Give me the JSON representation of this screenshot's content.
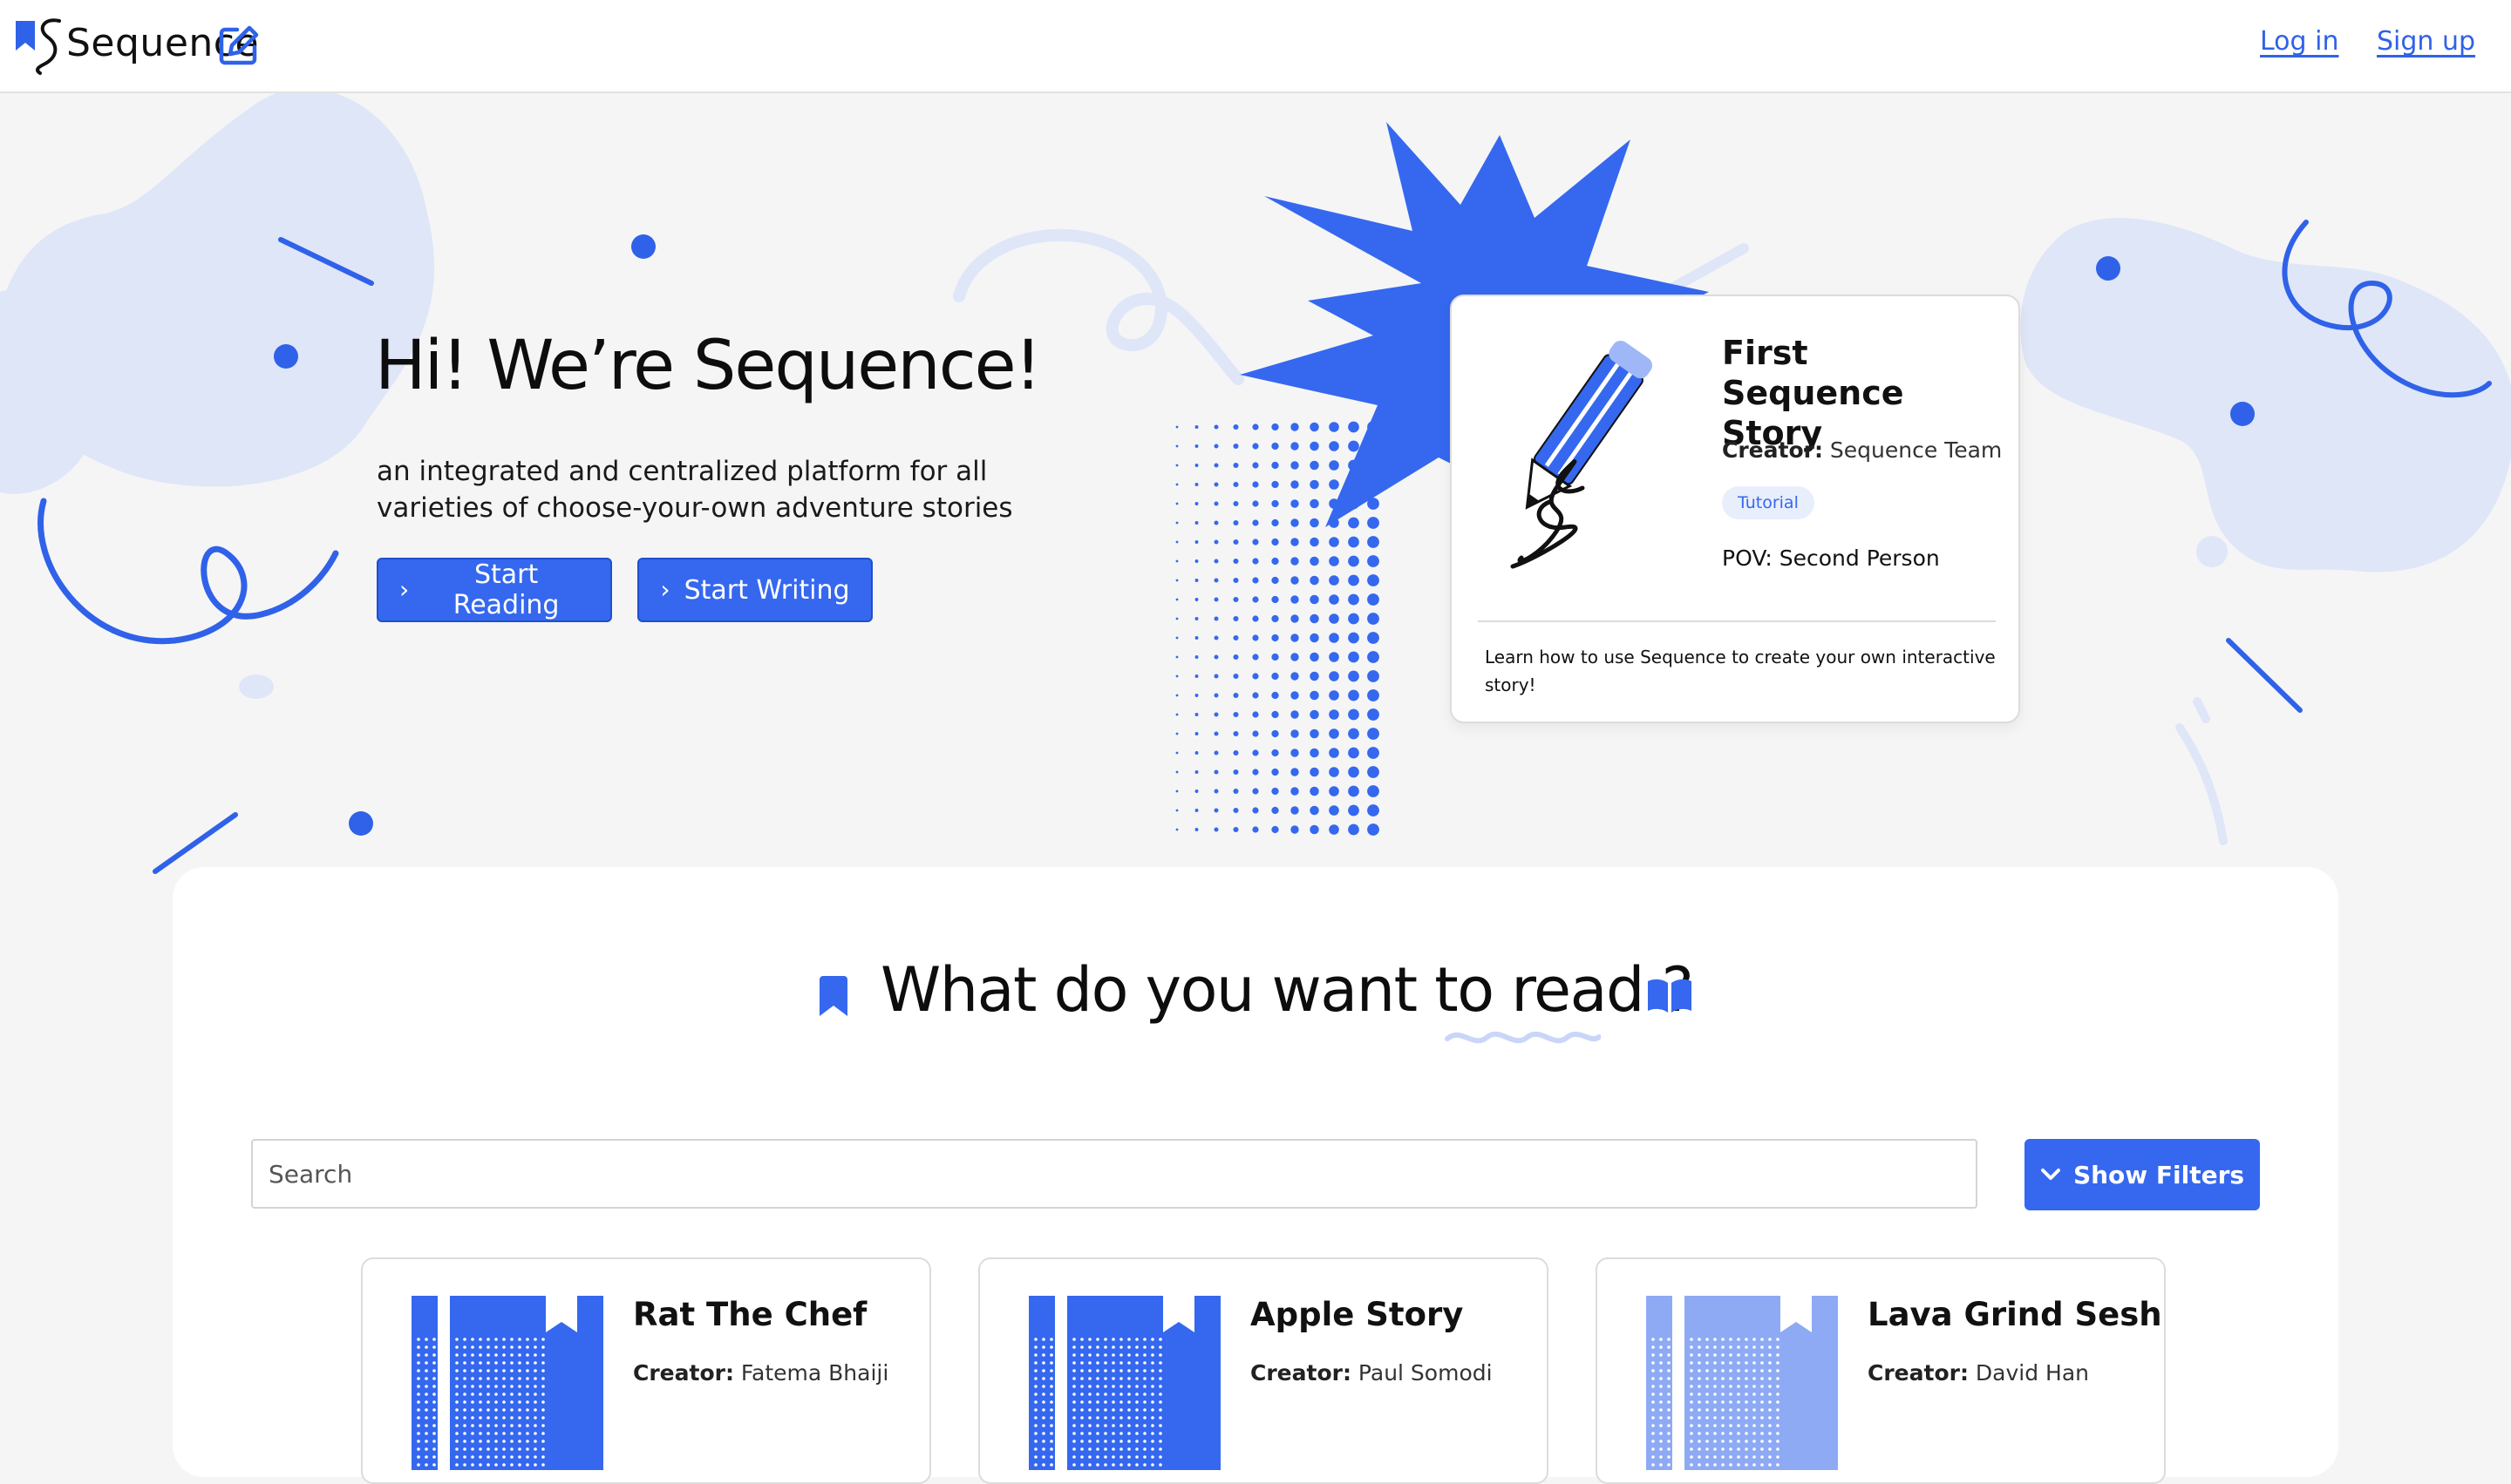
{
  "header": {
    "brand": "Sequence",
    "login_label": "Log in",
    "signup_label": "Sign up"
  },
  "hero": {
    "title": "Hi! We’re Sequence!",
    "subtitle": "an integrated and centralized platform for all varieties of choose-your-own adventure stories",
    "start_reading_label": "Start Reading",
    "start_writing_label": "Start Writing"
  },
  "featured": {
    "title": "First Sequence Story",
    "creator_label": "Creator:",
    "creator": "Sequence Team",
    "badge": "Tutorial",
    "pov": "POV: Second Person",
    "description": "Learn how to use Sequence to create your own interactive story!"
  },
  "browse": {
    "title": "What do you want to read ?",
    "search_placeholder": "Search",
    "filters_label": "Show Filters"
  },
  "stories": [
    {
      "title": "Rat The Chef",
      "creator_label": "Creator:",
      "creator": "Fatema Bhaiji"
    },
    {
      "title": "Apple Story",
      "creator_label": "Creator:",
      "creator": "Paul Somodi"
    },
    {
      "title": "Lava Grind Sesh",
      "creator_label": "Creator:",
      "creator": "David Han"
    }
  ],
  "colors": {
    "accent": "#3568ef",
    "accent_light": "#dfe6f8",
    "background": "#f5f5f5"
  },
  "icons": [
    "bookmark-icon",
    "edit-icon",
    "chevron-right-icon",
    "chevron-down-icon",
    "book-open-icon",
    "pencil-icon"
  ]
}
